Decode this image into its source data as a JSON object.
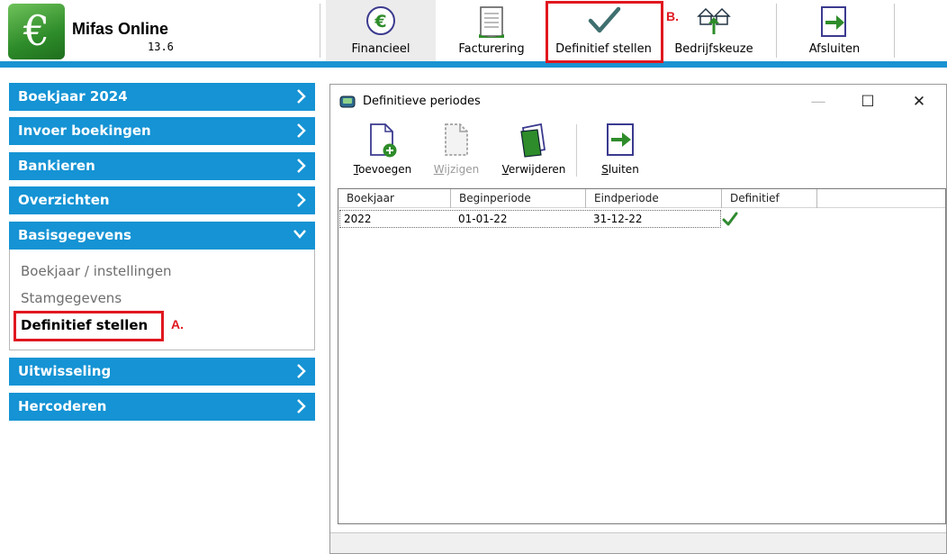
{
  "app": {
    "name": "Mifas Online",
    "version": "13.6",
    "logo_glyph": "€"
  },
  "toolbar": {
    "buttons": [
      {
        "label": "Financieel",
        "icon": "euro-circle-icon"
      },
      {
        "label": "Facturering",
        "icon": "invoice-document-icon"
      },
      {
        "label": "Definitief stellen",
        "icon": "checkmark-icon"
      },
      {
        "label": "Bedrijfskeuze",
        "icon": "houses-icon"
      },
      {
        "label": "Afsluiten",
        "icon": "exit-arrow-icon"
      }
    ]
  },
  "annotations": {
    "a": "A.",
    "b": "B."
  },
  "sidebar": {
    "items": [
      {
        "label": "Boekjaar 2024"
      },
      {
        "label": "Invoer boekingen"
      },
      {
        "label": "Bankieren"
      },
      {
        "label": "Overzichten"
      },
      {
        "label": "Basisgegevens",
        "expanded": true
      },
      {
        "label": "Uitwisseling"
      },
      {
        "label": "Hercoderen"
      }
    ],
    "subitems": [
      {
        "label": "Boekjaar / instellingen"
      },
      {
        "label": "Stamgegevens"
      },
      {
        "label": "Definitief stellen",
        "current": true
      }
    ]
  },
  "window": {
    "title": "Definitieve periodes",
    "controls": {
      "minimize": "—",
      "maximize": "☐",
      "close": "✕"
    },
    "toolbar": [
      {
        "label_first": "T",
        "label_rest": "oevoegen",
        "icon": "new-document-add-icon",
        "enabled": true
      },
      {
        "label_first": "W",
        "label_rest": "ijzigen",
        "icon": "edit-document-icon",
        "enabled": false
      },
      {
        "label_first": "V",
        "label_rest": "erwijderen",
        "icon": "delete-documents-icon",
        "enabled": true
      },
      {
        "label_first": "S",
        "label_rest": "luiten",
        "icon": "close-arrow-icon",
        "enabled": true
      }
    ],
    "table": {
      "columns": [
        "Boekjaar",
        "Beginperiode",
        "Eindperiode",
        "Definitief"
      ],
      "rows": [
        {
          "boekjaar": "2022",
          "beginperiode": "01-01-22",
          "eindperiode": "31-12-22",
          "definitief": true
        }
      ]
    }
  },
  "colors": {
    "accent": "#1593d4",
    "highlight": "#e0171f",
    "check": "#2f8a2f"
  }
}
